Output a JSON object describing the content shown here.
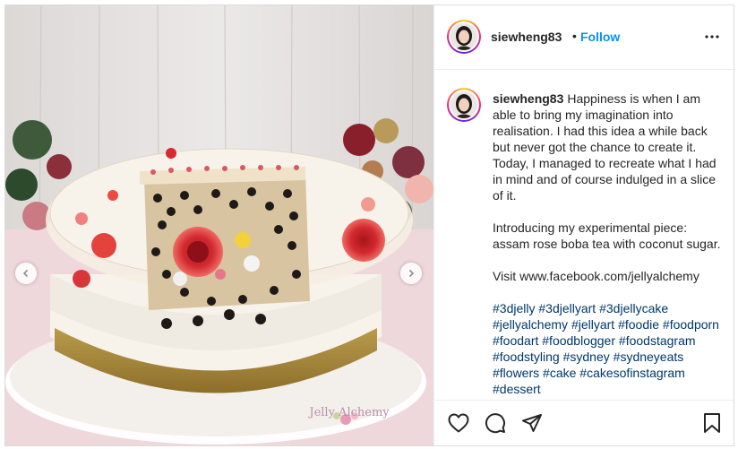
{
  "post": {
    "author": "siewheng83",
    "follow_label": "Follow",
    "separator": "•",
    "watermark": "Jelly Alchemy",
    "caption": {
      "username": "siewheng83",
      "paragraph1": "Happiness is when I am able to bring my imagination into realisation. I had this idea a while back but never got the chance to create it. Today, I managed to recreate what I had in mind and of course indulged in a slice of it.",
      "paragraph2": "Introducing my experimental piece: assam rose boba tea with coconut sugar.",
      "paragraph3": "Visit www.facebook.com/jellyalchemy",
      "hashtags": [
        "#3djelly",
        "#3djellyart",
        "#3djellycake",
        "#jellyalchemy",
        "#jellyart",
        "#foodie",
        "#foodporn",
        "#foodart",
        "#foodblogger",
        "#foodstagram",
        "#foodstyling",
        "#sydney",
        "#sydneyeats",
        "#flowers",
        "#cake",
        "#cakesofinstagram",
        "#dessert"
      ]
    },
    "icons": {
      "like": "heart-icon",
      "comment": "comment-icon",
      "share": "paper-plane-icon",
      "save": "bookmark-icon",
      "more": "more-dots-icon",
      "prev": "chevron-left-icon",
      "next": "chevron-right-icon"
    },
    "colors": {
      "follow": "#0095f6",
      "hashtag": "#00376b",
      "text": "#262626",
      "border": "#dbdbdb"
    }
  }
}
